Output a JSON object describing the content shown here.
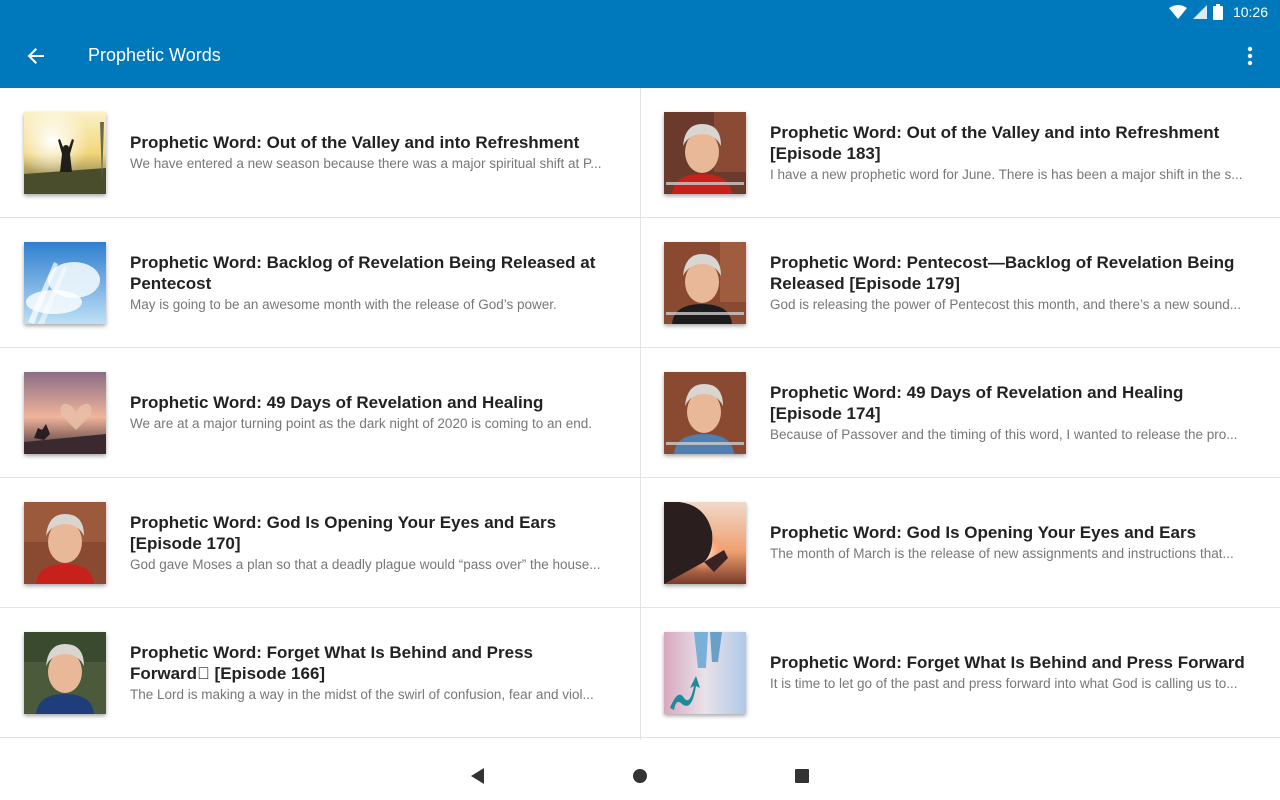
{
  "status_bar": {
    "time": "10:26",
    "icons": [
      "wifi-icon",
      "signal-icon",
      "battery-icon"
    ]
  },
  "app_bar": {
    "title": "Prophetic Words",
    "back_icon": "arrow-back-icon",
    "menu_icon": "more-vert-icon"
  },
  "colors": {
    "primary": "#0079bc",
    "title_text": "#222222",
    "desc_text": "#777777",
    "divider": "#e3e3e3"
  },
  "left_column": [
    {
      "title": "Prophetic Word: Out of the Valley and into Refreshment",
      "description": "We have entered a new season because there was a major spiritual shift at P...",
      "thumb": "sunrise-woman"
    },
    {
      "title": "Prophetic Word: Backlog of Revelation Being Released at Pentecost",
      "description": "May is going to be an awesome month with the release of God’s power.",
      "thumb": "angel-sky"
    },
    {
      "title": "Prophetic Word: 49 Days of Revelation and Healing",
      "description": "We are at a major turning point as the dark night of 2020 is coming to an end.",
      "thumb": "heart-book"
    },
    {
      "title": "Prophetic Word: God Is Opening Your Eyes and Ears [Episode 170]",
      "description": "God gave Moses a plan so that a deadly plague would “pass over” the house...",
      "thumb": "man-red"
    },
    {
      "title": "Prophetic Word: Forget What Is Behind and Press Forward\u0000 [Episode 166]",
      "description": "The Lord is making a way in the midst of the swirl of confusion, fear and viol...",
      "thumb": "man-blue"
    }
  ],
  "right_column": [
    {
      "title": "Prophetic Word: Out of the Valley and into Refreshment [Episode 183]",
      "description": "I have a new prophetic word for June. There is has been a major shift in the s...",
      "thumb": "man-red-video"
    },
    {
      "title": "Prophetic Word: Pentecost—Backlog of Revelation Being Released [Episode 179]",
      "description": "God is releasing the power of Pentecost this month, and there’s a new sound...",
      "thumb": "man-black-video"
    },
    {
      "title": "Prophetic Word: 49 Days of Revelation and Healing [Episode 174]",
      "description": "Because of Passover and the timing of this word, I wanted to release the pro...",
      "thumb": "man-denim-video"
    },
    {
      "title": "Prophetic Word: God Is Opening Your Eyes and Ears",
      "description": "The month of March is the release of new assignments and instructions that...",
      "thumb": "hand-sunset"
    },
    {
      "title": "Prophetic Word: Forget What Is Behind and Press Forward",
      "description": "It is time to let go of the past and press forward into what God is calling us to...",
      "thumb": "feet-arrow"
    }
  ],
  "nav_bar": {
    "icons": [
      "back-triangle-icon",
      "home-circle-icon",
      "recents-square-icon"
    ]
  }
}
